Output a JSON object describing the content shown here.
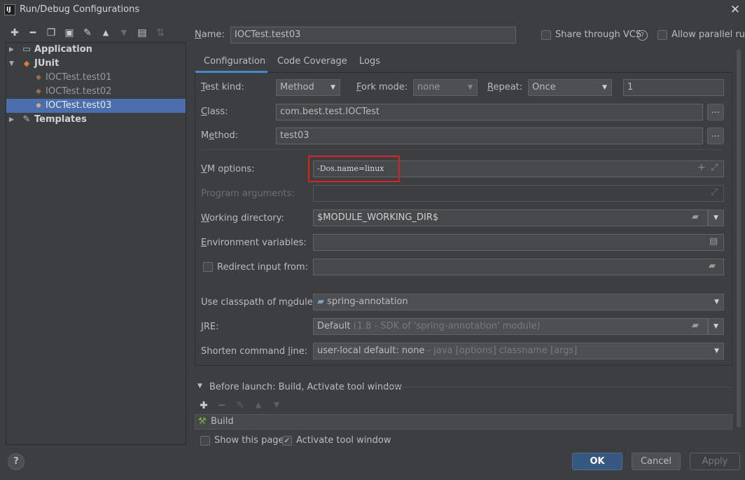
{
  "window": {
    "title": "Run/Debug Configurations",
    "app_icon": "IJ"
  },
  "toolbar": {
    "icons": [
      "add-icon",
      "remove-icon",
      "copy-icon",
      "save-icon",
      "wrench-icon",
      "move-up-icon",
      "move-down-icon",
      "folder-add-icon",
      "sort-icon"
    ]
  },
  "tree": {
    "application": "Application",
    "junit": "JUnit",
    "test01": "IOCTest.test01",
    "test02": "IOCTest.test02",
    "test03": "IOCTest.test03",
    "templates": "Templates"
  },
  "header": {
    "name_label": "Name:",
    "name_value": "IOCTest.test03",
    "share_vcs": "Share through VCS",
    "allow_parallel": "Allow parallel run"
  },
  "tabs": {
    "configuration": "Configuration",
    "coverage": "Code Coverage",
    "logs": "Logs"
  },
  "config": {
    "test_kind_label": "Test kind:",
    "test_kind_value": "Method",
    "fork_mode_label": "Fork mode:",
    "fork_mode_value": "none",
    "repeat_label": "Repeat:",
    "repeat_value": "Once",
    "repeat_count": "1",
    "class_label": "Class:",
    "class_value": "com.best.test.IOCTest",
    "method_label": "Method:",
    "method_value": "test03",
    "dots": "...",
    "vm_options_label": "VM options:",
    "vm_options_value": "-Dos.name=linux",
    "program_args_label": "Program arguments:",
    "working_dir_label": "Working directory:",
    "working_dir_value": "$MODULE_WORKING_DIR$",
    "env_vars_label": "Environment variables:",
    "redirect_label": "Redirect input from:",
    "classpath_label": "Use classpath of module:",
    "classpath_value": "spring-annotation",
    "jre_label": "JRE:",
    "jre_value": "Default",
    "jre_detail": "(1.8 - SDK of 'spring-annotation' module)",
    "shorten_label": "Shorten command line:",
    "shorten_value": "user-local default: none",
    "shorten_detail": "- java [options] classname [args]"
  },
  "before_launch": {
    "title": "Before launch: Build, Activate tool window",
    "build": "Build",
    "show_page": "Show this page",
    "activate_tool": "Activate tool window"
  },
  "buttons": {
    "ok": "OK",
    "cancel": "Cancel",
    "apply": "Apply",
    "help": "?"
  }
}
